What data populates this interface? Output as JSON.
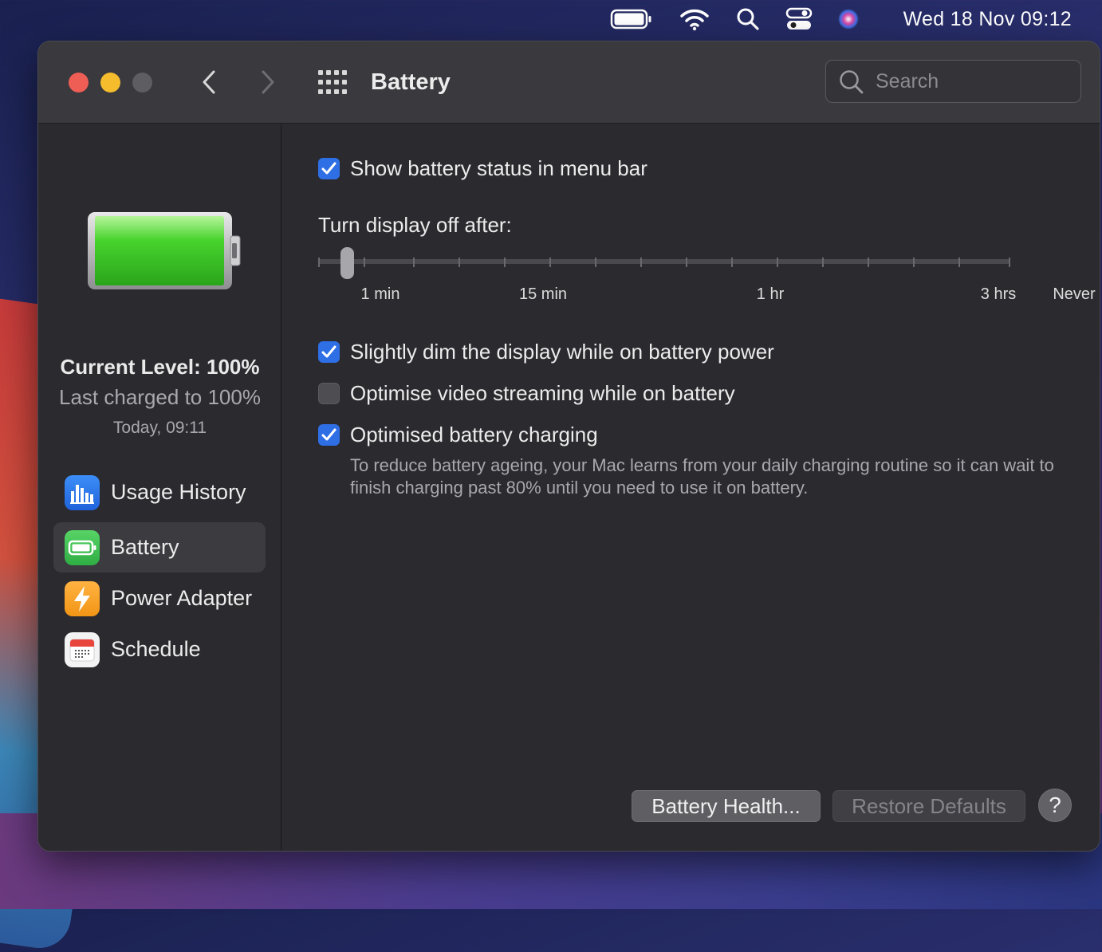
{
  "menubar": {
    "clock": "Wed 18 Nov  09:12",
    "icons": [
      "battery-icon",
      "wifi-icon",
      "search-icon",
      "control-center-icon",
      "siri-icon"
    ]
  },
  "window": {
    "title": "Battery",
    "search_placeholder": "Search"
  },
  "sidebar": {
    "current_level": "Current Level: 100%",
    "last_charged": "Last charged to 100%",
    "last_charged_time": "Today, 09:11",
    "battery_fill_fraction": 1.0,
    "items": [
      {
        "label": "Usage History",
        "icon": "bar-chart-icon",
        "selected": false
      },
      {
        "label": "Battery",
        "icon": "battery-icon",
        "selected": true
      },
      {
        "label": "Power Adapter",
        "icon": "lightning-icon",
        "selected": false
      },
      {
        "label": "Schedule",
        "icon": "calendar-icon",
        "selected": false
      }
    ]
  },
  "main": {
    "show_status": {
      "label": "Show battery status in menu bar",
      "checked": true
    },
    "slider": {
      "title": "Turn display off after:",
      "labels": [
        "1 min",
        "15 min",
        "1 hr",
        "3 hrs",
        "Never"
      ],
      "value": "1 min"
    },
    "dim_display": {
      "label": "Slightly dim the display while on battery power",
      "checked": true
    },
    "optimise_video": {
      "label": "Optimise video streaming while on battery",
      "checked": false
    },
    "optimised_charging": {
      "label": "Optimised battery charging",
      "checked": true,
      "description": "To reduce battery ageing, your Mac learns from your daily charging routine so it can wait to finish charging past 80% until you need to use it on battery."
    },
    "buttons": {
      "battery_health": "Battery Health...",
      "restore_defaults": "Restore Defaults",
      "help": "?"
    }
  },
  "colors": {
    "accent": "#2f6fe6",
    "battery_green": "#3ccf2a",
    "close": "#ee5e55",
    "minimize": "#f5bd2e"
  }
}
